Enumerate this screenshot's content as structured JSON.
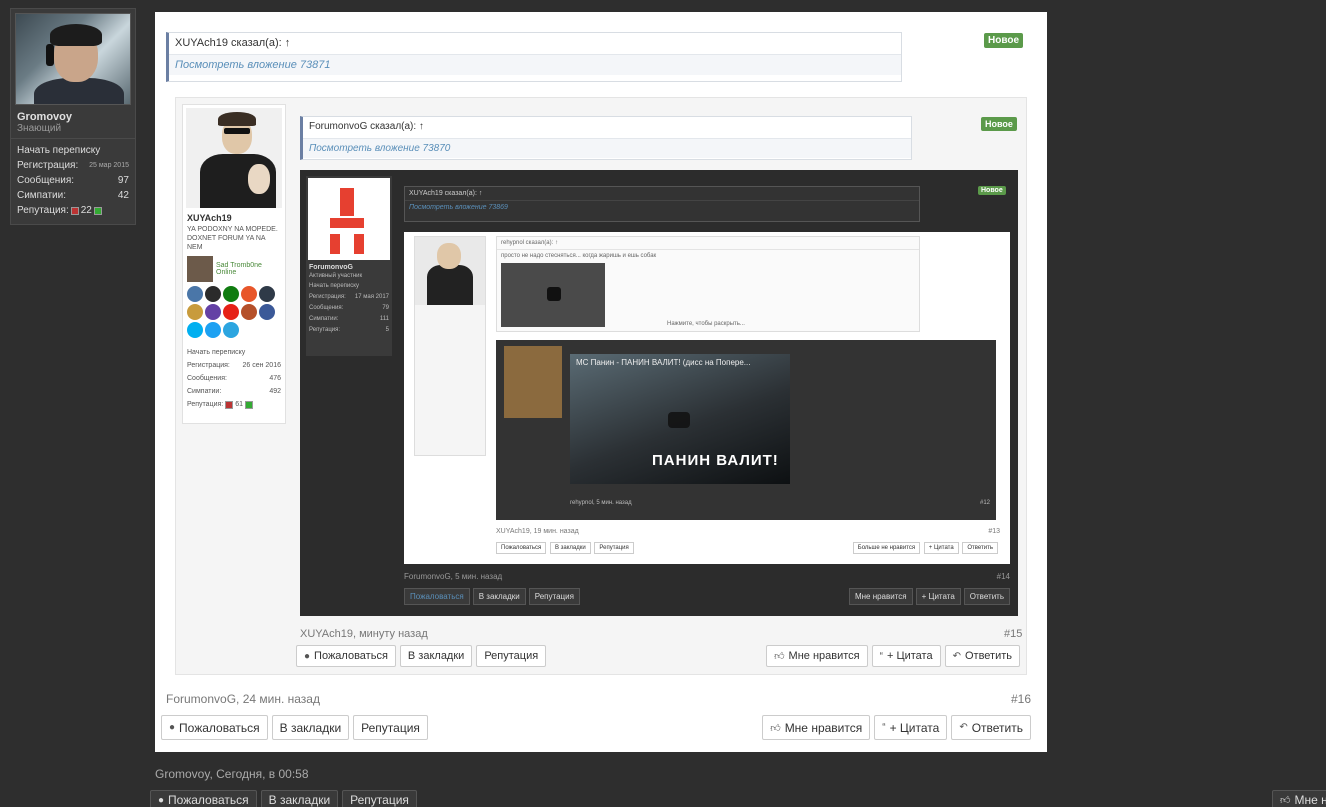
{
  "user_card": {
    "name": "Gromovoy",
    "title": "Знающий",
    "start_conversation": "Начать переписку",
    "stats": [
      {
        "label": "Регистрация:",
        "value": "25 мар 2015"
      },
      {
        "label": "Сообщения:",
        "value": "97"
      },
      {
        "label": "Симпатии:",
        "value": "42"
      }
    ],
    "reputation_label": "Репутация:",
    "reputation_value": "22"
  },
  "outer_post": {
    "quote_author": "XUYAch19 сказал(а): ↑",
    "quote_link": "Посмотреть вложение 73871",
    "badge_new": "Новое",
    "footer_meta": "ForumonvoG, 24 мин. назад",
    "post_number": "#16",
    "buttons_left": [
      "Пожаловаться",
      "В закладки",
      "Репутация"
    ],
    "buttons_right": [
      "Мне нравится",
      "+ Цитата",
      "Ответить"
    ]
  },
  "inner_post": {
    "user": {
      "name": "XUYAch19",
      "title": "YA PODOXNY NA MOPEDE. DOXNET FORUM YA NA NEM",
      "online_name": "Sad Tromb0ne",
      "online_status": "Online",
      "start_conversation": "Начать переписку",
      "stats": [
        {
          "label": "Регистрация:",
          "value": "26 сен 2016"
        },
        {
          "label": "Сообщения:",
          "value": "476"
        },
        {
          "label": "Симпатии:",
          "value": "492"
        }
      ],
      "reputation_label": "Репутация:",
      "reputation_value": "61"
    },
    "quote_author": "ForumonvoG сказал(а): ↑",
    "quote_link": "Посмотреть вложение 73870",
    "badge_new": "Новое",
    "footer_meta": "XUYAch19, минуту назад",
    "post_number": "#15",
    "buttons_left": [
      "Пожаловаться",
      "В закладки",
      "Репутация"
    ],
    "buttons_right": [
      "Мне нравится",
      "+ Цитата",
      "Ответить"
    ]
  },
  "embedded_shot": {
    "user_name": "ForumonvoG",
    "user_title": "Активный участник",
    "stats": [
      {
        "label": "Начать переписку",
        "value": ""
      },
      {
        "label": "Регистрация:",
        "value": "17 мая 2017"
      },
      {
        "label": "Сообщения:",
        "value": "79"
      },
      {
        "label": "Симпатии:",
        "value": "111"
      },
      {
        "label": "Репутация:",
        "value": "5"
      }
    ],
    "quote_author": "XUYAch19 сказал(а): ↑",
    "quote_link": "Посмотреть вложение 73869",
    "badge_new": "Новое",
    "white_quote_author": "rehypnol сказал(а): ↑",
    "white_quote_text": "просто не надо стесняться... когда жаришь и ешь собак",
    "white_quote_expand": "Нажмите, чтобы раскрыть...",
    "video_title": "MC Панин - ПАНИН ВАЛИТ! (дисс на Попере...",
    "video_caption": "ПАНИН ВАЛИТ!",
    "dark_footer": "rehypnol, 5 мин. назад",
    "dark_number": "#12",
    "inner_footer": "XUYAch19, 19 мин. назад",
    "inner_number": "#13",
    "inner_buttons": [
      "Пожаловаться",
      "В закладки",
      "Репутация"
    ],
    "inner_buttons_right": [
      "Больше не нравится",
      "+ Цитата",
      "Ответить"
    ],
    "footer": "ForumonvoG, 5 мин. назад",
    "number": "#14",
    "buttons": [
      "Пожаловаться",
      "В закладки",
      "Репутация"
    ],
    "buttons_right": [
      "Мне нравится",
      "+ Цитата",
      "Ответить"
    ]
  },
  "bottom": {
    "meta": "Gromovoy, Сегодня, в 00:58",
    "buttons": [
      "Пожаловаться",
      "В закладки",
      "Репутация"
    ],
    "right_button": "Мне н"
  },
  "colors": {
    "background": "#2e2e2e",
    "new_badge": "#5b9a4a",
    "link": "#5a8fb9",
    "quote_border": "#6b7fa3"
  }
}
